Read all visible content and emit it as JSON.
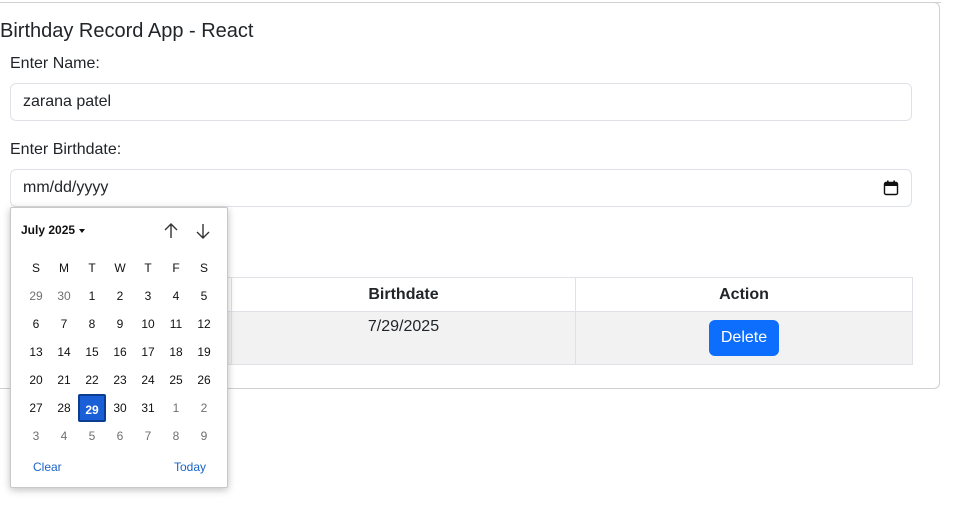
{
  "app": {
    "title": "Birthday Record App - React"
  },
  "form": {
    "name_label": "Enter Name:",
    "name_value": "zarana patel",
    "birthdate_label": "Enter Birthdate:",
    "birthdate_placeholder": "mm/dd/yyyy"
  },
  "table": {
    "headers": [
      "",
      "Birthdate",
      "Action"
    ],
    "rows": [
      {
        "name": "",
        "birthdate": "7/29/2025",
        "action_label": "Delete"
      }
    ]
  },
  "datepicker": {
    "month_label": "July 2025",
    "weekdays": [
      "S",
      "M",
      "T",
      "W",
      "T",
      "F",
      "S"
    ],
    "weeks": [
      [
        "29",
        "30",
        "1",
        "2",
        "3",
        "4",
        "5"
      ],
      [
        "6",
        "7",
        "8",
        "9",
        "10",
        "11",
        "12"
      ],
      [
        "13",
        "14",
        "15",
        "16",
        "17",
        "18",
        "19"
      ],
      [
        "20",
        "21",
        "22",
        "23",
        "24",
        "25",
        "26"
      ],
      [
        "27",
        "28",
        "29",
        "30",
        "31",
        "1",
        "2"
      ],
      [
        "3",
        "4",
        "5",
        "6",
        "7",
        "8",
        "9"
      ]
    ],
    "selected_day": "29",
    "clear_label": "Clear",
    "today_label": "Today"
  },
  "colors": {
    "primary": "#0d6efd",
    "selected_day": "#1a5fd6",
    "link": "#1a63c6",
    "row_bg": "#f2f2f2"
  },
  "icons": {
    "calendar": "calendar-icon",
    "prev": "arrow-up-icon",
    "next": "arrow-down-icon",
    "month_menu": "caret-down-icon"
  }
}
